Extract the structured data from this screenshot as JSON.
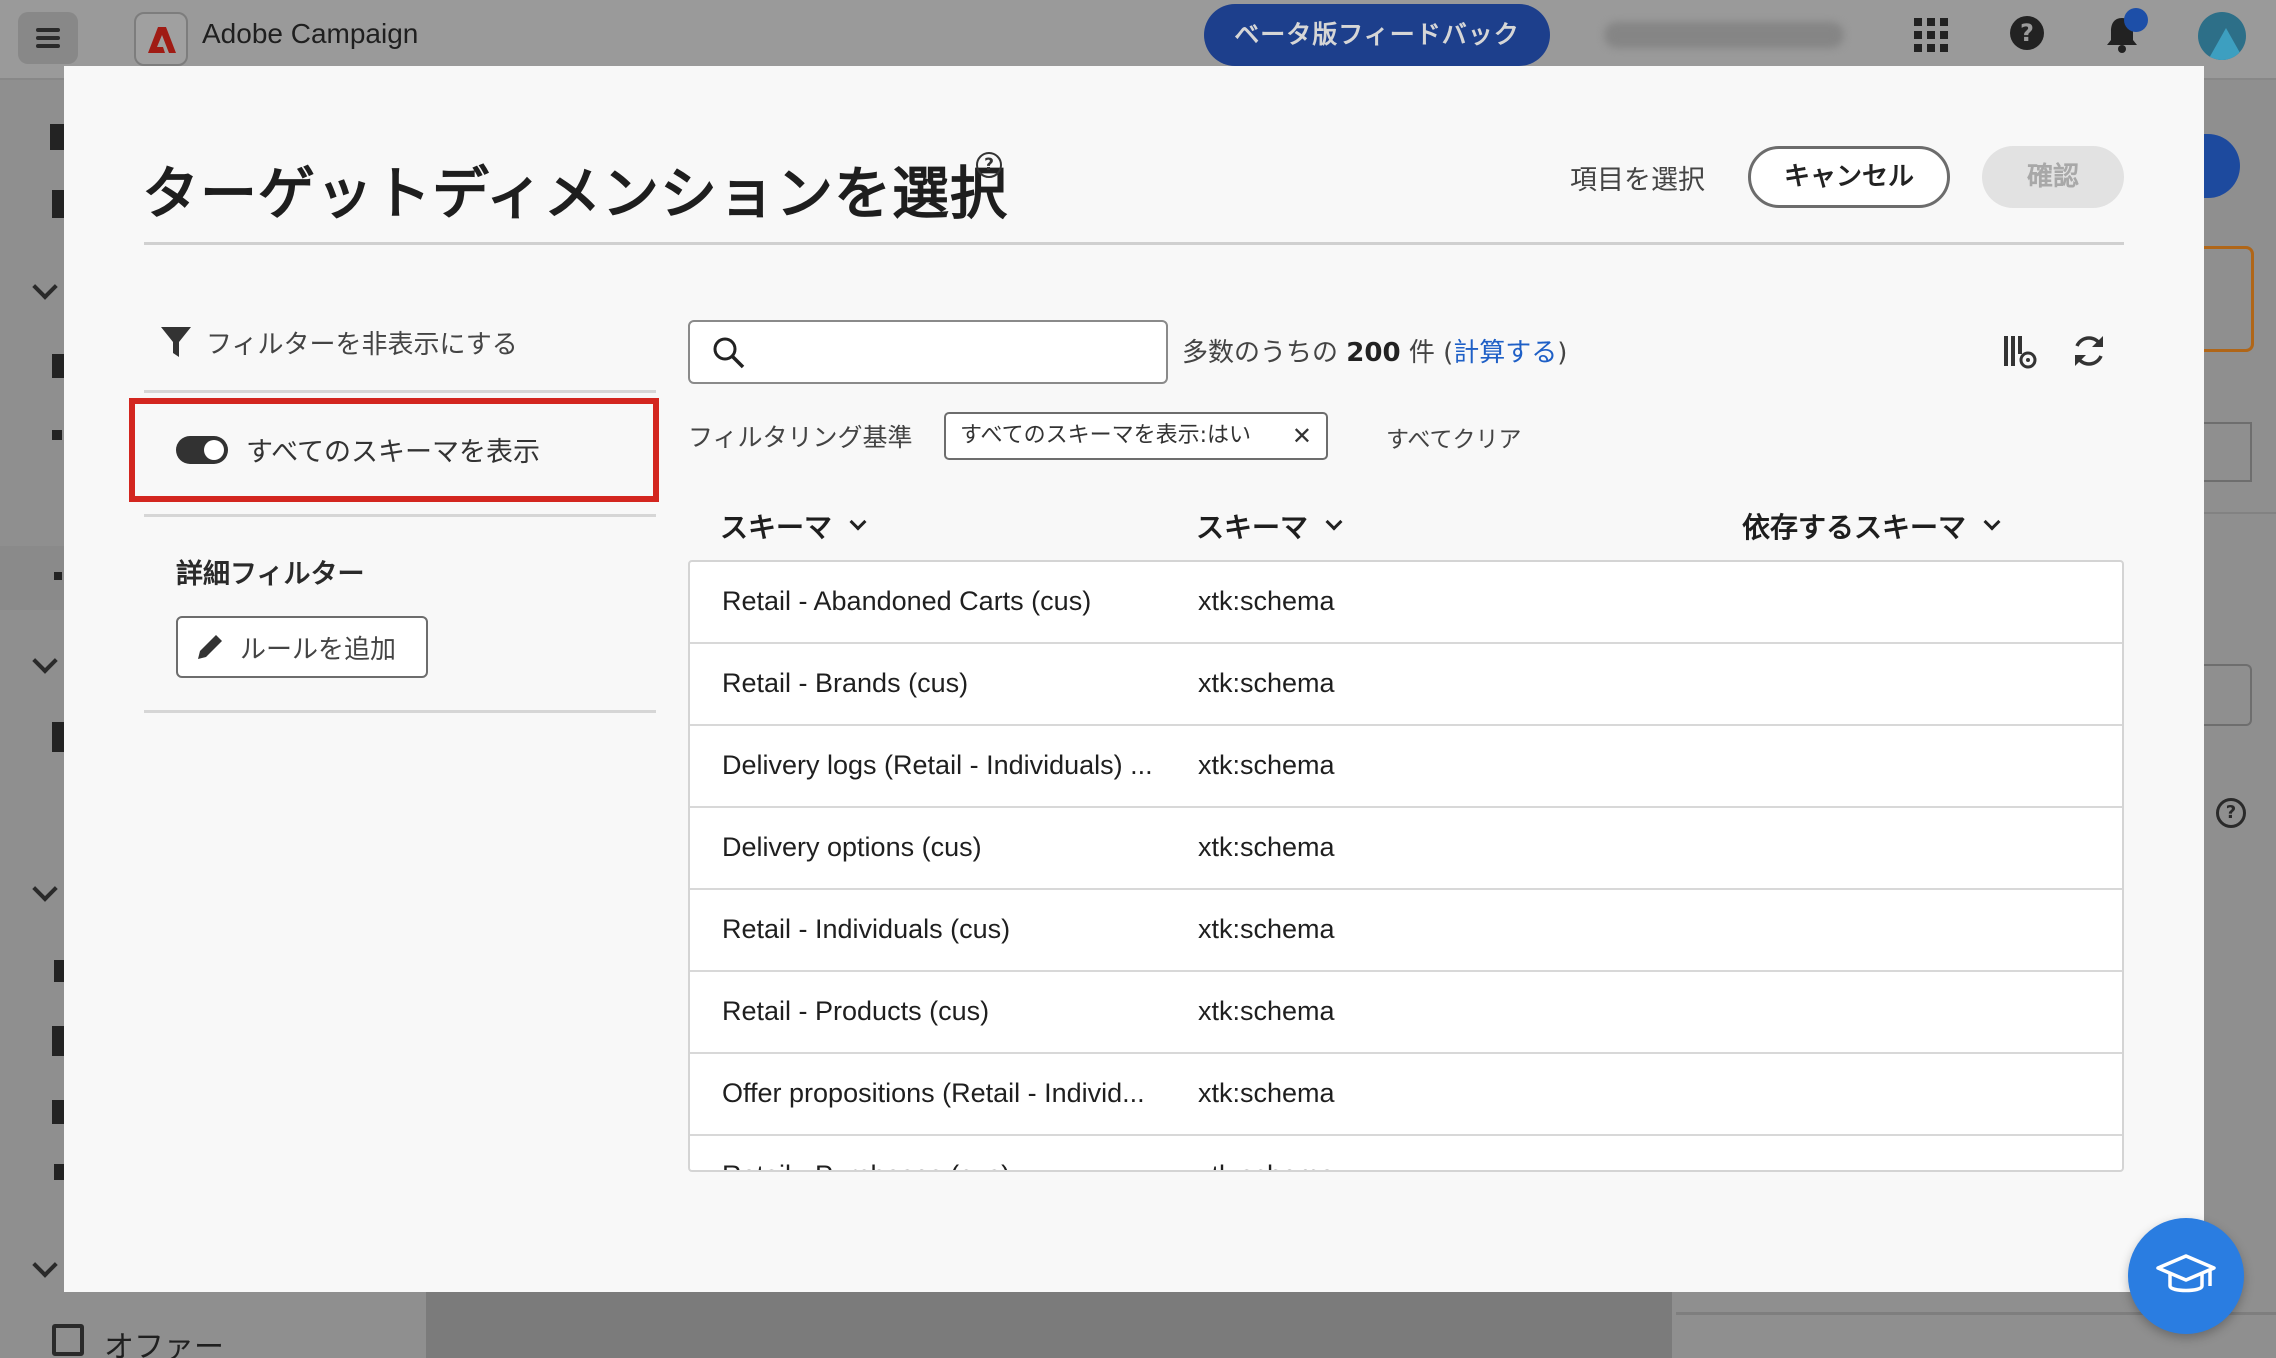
{
  "app": {
    "title": "Adobe Campaign",
    "beta_feedback": "ベータ版フィードバック",
    "offer_nav_label": "オファー"
  },
  "modal": {
    "title": "ターゲットディメンションを選択",
    "select_item_label": "項目を選択",
    "cancel_label": "キャンセル",
    "confirm_label": "確認"
  },
  "filters": {
    "hide_filters_label": "フィルターを非表示にする",
    "show_all_schemas_label": "すべてのスキーマを表示",
    "show_all_schemas_enabled": true,
    "advanced_filter_heading": "詳細フィルター",
    "add_rule_label": "ルールを追加"
  },
  "list": {
    "search": {
      "value": "",
      "placeholder": ""
    },
    "count_prefix": "多数のうちの",
    "count_value": "200",
    "count_unit": "件",
    "compute_link": "計算する",
    "filter_by_label": "フィルタリング基準",
    "active_filter_chip": "すべてのスキーマを表示:はい",
    "clear_all_label": "すべてクリア",
    "columns": [
      "スキーマ",
      "スキーマ",
      "依存するスキーマ"
    ],
    "rows": [
      {
        "schema": "Retail - Abandoned Carts (cus)",
        "type": "xtk:schema",
        "dependent": ""
      },
      {
        "schema": "Retail - Brands (cus)",
        "type": "xtk:schema",
        "dependent": ""
      },
      {
        "schema": "Delivery logs (Retail - Individuals) ...",
        "type": "xtk:schema",
        "dependent": ""
      },
      {
        "schema": "Delivery options (cus)",
        "type": "xtk:schema",
        "dependent": ""
      },
      {
        "schema": "Retail - Individuals (cus)",
        "type": "xtk:schema",
        "dependent": ""
      },
      {
        "schema": "Retail - Products (cus)",
        "type": "xtk:schema",
        "dependent": ""
      },
      {
        "schema": "Offer propositions (Retail - Individ...",
        "type": "xtk:schema",
        "dependent": ""
      },
      {
        "schema": "Retail - Purchases (cus)",
        "type": "xtk:schema",
        "dependent": ""
      }
    ]
  },
  "colors": {
    "highlight_border": "#d3261f",
    "link": "#1e5fc6",
    "beta_button": "#1d3f8c",
    "help_fab": "#2a7de1"
  },
  "icons": [
    "menu-icon",
    "adobe-logo-icon",
    "apps-grid-icon",
    "help-icon",
    "bell-icon",
    "avatar",
    "filter-funnel-icon",
    "pencil-icon",
    "search-icon",
    "column-settings-icon",
    "refresh-icon",
    "chevron-down-icon",
    "close-icon",
    "graduation-cap-icon"
  ]
}
